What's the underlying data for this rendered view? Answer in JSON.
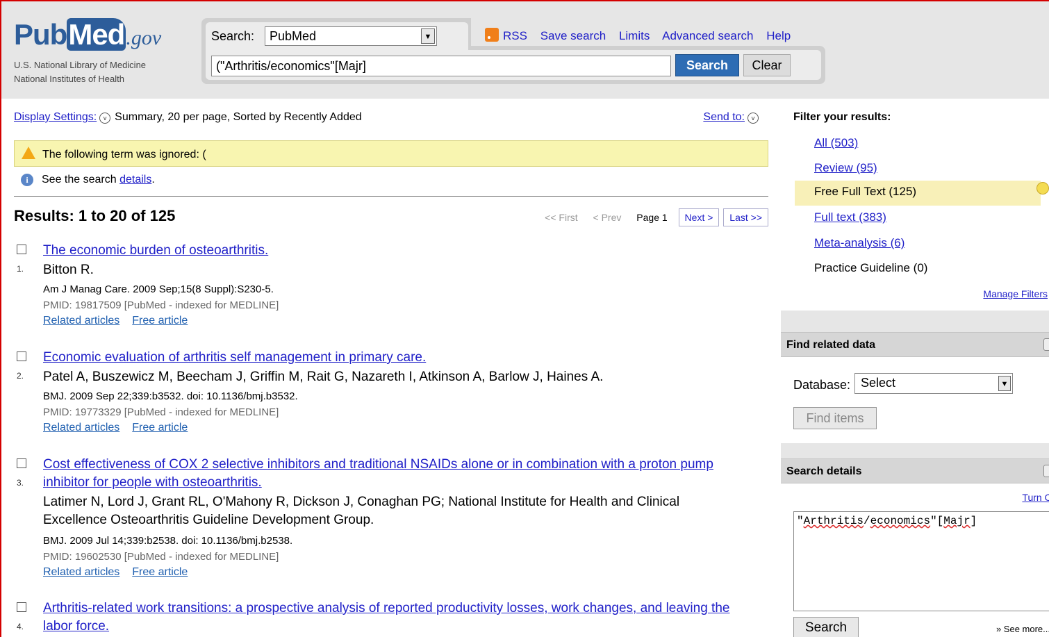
{
  "logo": {
    "pub": "Pub",
    "med": "Med",
    "gov": ".gov",
    "line1": "U.S. National Library of Medicine",
    "line2": "National Institutes of Health"
  },
  "search": {
    "db_label": "Search:",
    "db_value": "PubMed",
    "term": "(\"Arthritis/economics\"[Majr]",
    "search_btn": "Search",
    "clear_btn": "Clear",
    "links": {
      "rss": "RSS",
      "save": "Save search",
      "limits": "Limits",
      "advanced": "Advanced search",
      "help": "Help"
    }
  },
  "display": {
    "settings_link": "Display Settings:",
    "settings_value": "Summary, 20 per page, Sorted by Recently Added",
    "send_to": "Send to:"
  },
  "warning": "The following term was ignored: (",
  "info": {
    "prefix": "See the search ",
    "link": "details",
    "suffix": "."
  },
  "results": {
    "title": "Results: 1 to 20 of 125",
    "pager": {
      "first": "<< First",
      "prev": "< Prev",
      "page": "Page 1",
      "next": "Next >",
      "last": "Last >>"
    },
    "items": [
      {
        "num": "1.",
        "title": "The economic burden of osteoarthritis.",
        "authors": "Bitton R.",
        "cite": "Am J Manag Care. 2009 Sep;15(8 Suppl):S230-5.",
        "pmid": "PMID: 19817509 [PubMed - indexed for MEDLINE]",
        "related": "Related articles",
        "free": "Free article"
      },
      {
        "num": "2.",
        "title": "Economic evaluation of arthritis self management in primary care.",
        "authors": "Patel A, Buszewicz M, Beecham J, Griffin M, Rait G, Nazareth I, Atkinson A, Barlow J, Haines A.",
        "cite": "BMJ. 2009 Sep 22;339:b3532. doi: 10.1136/bmj.b3532.",
        "pmid": "PMID: 19773329 [PubMed - indexed for MEDLINE]",
        "related": "Related articles",
        "free": "Free article"
      },
      {
        "num": "3.",
        "title": "Cost effectiveness of COX 2 selective inhibitors and traditional NSAIDs alone or in combination with a proton pump inhibitor for people with osteoarthritis.",
        "authors": "Latimer N, Lord J, Grant RL, O'Mahony R, Dickson J, Conaghan PG; National Institute for Health and Clinical Excellence Osteoarthritis Guideline Development Group.",
        "cite": "BMJ. 2009 Jul 14;339:b2538. doi: 10.1136/bmj.b2538.",
        "pmid": "PMID: 19602530 [PubMed - indexed for MEDLINE]",
        "related": "Related articles",
        "free": "Free article"
      },
      {
        "num": "4.",
        "title": "Arthritis-related work transitions: a prospective analysis of reported productivity losses, work changes, and leaving the labor force."
      }
    ]
  },
  "filters": {
    "title": "Filter your results:",
    "items": [
      "All (503)",
      "Review (95)",
      "Free Full Text (125)",
      "Full text (383)",
      "Meta-analysis (6)",
      "Practice Guideline (0)"
    ],
    "manage": "Manage Filters"
  },
  "related_data": {
    "title": "Find related data",
    "db_label": "Database:",
    "db_value": "Select",
    "find_btn": "Find items"
  },
  "search_details": {
    "title": "Search details",
    "turn_off": "Turn Off",
    "query_pre": "\"",
    "query_w1": "Arthritis",
    "query_mid": "/",
    "query_w2": "economics",
    "query_post": "\"[",
    "query_w3": "Majr",
    "query_end": "]",
    "search_btn": "Search",
    "see_more": "» See more..."
  },
  "colors": {
    "accent": "#2d6cb4",
    "border": "#d40000",
    "warn_bg": "#f8f5b0",
    "filter_active": "#f8f0b8"
  }
}
